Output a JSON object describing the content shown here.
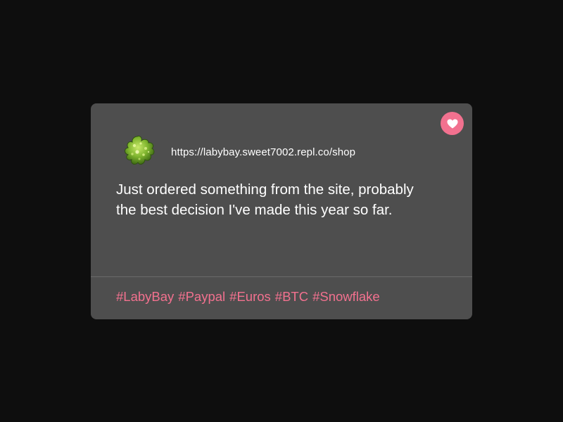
{
  "post": {
    "url": "https://labybay.sweet7002.repl.co/shop",
    "message": "Just ordered something from the site, probably the best decision I've made this year so far.",
    "tags": [
      "#LabyBay",
      "#Paypal",
      "#Euros",
      "#BTC",
      "#Snowflake"
    ],
    "avatar_icon": "green-crystal-icon",
    "like_icon": "heart-icon"
  },
  "colors": {
    "page_background": "#0e0e0e",
    "card_background": "#4e4e4e",
    "accent": "#f2718f",
    "text": "#ffffff"
  }
}
